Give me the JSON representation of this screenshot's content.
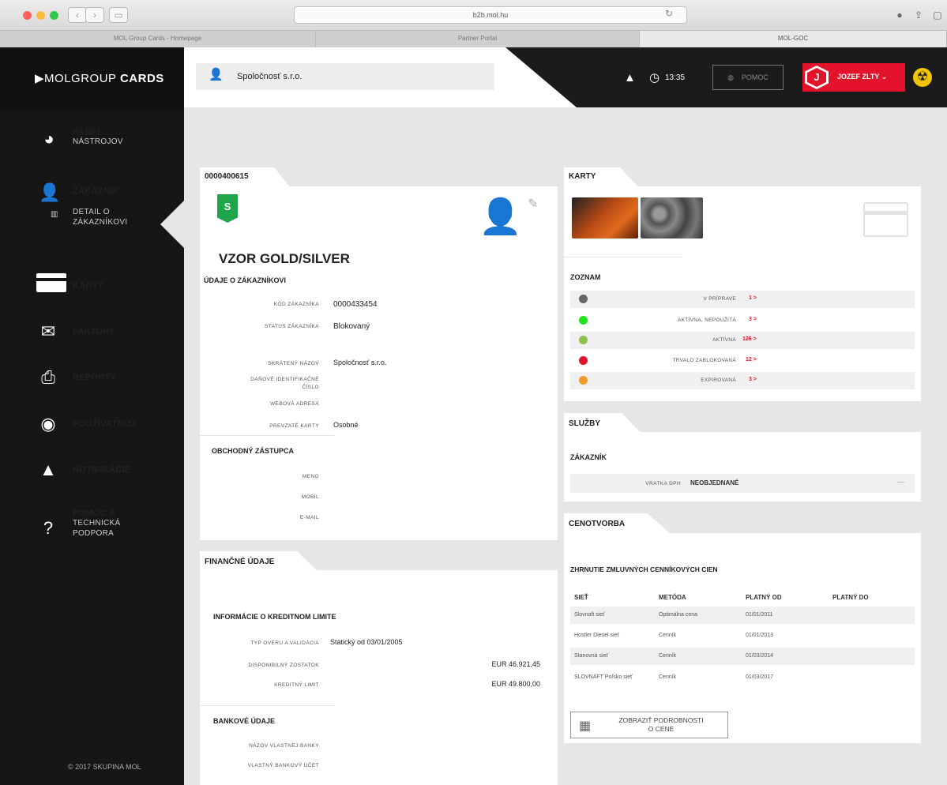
{
  "browser": {
    "url": "b2b.mol.hu",
    "tabs": [
      "MOL Group Cards - Homepage",
      "Partner Portal",
      "MOL-GOC"
    ]
  },
  "sidebar": {
    "logo_prefix": "MOLGROUP",
    "logo_bold": "CARDS",
    "items": [
      {
        "icon": "dashboard-icon",
        "label": "PANEL",
        "sub": "NÁSTROJOV"
      },
      {
        "icon": "user-icon",
        "label": "ZÁKAZNÍK",
        "sub": "DETAIL O ZÁKAZNÍKOVI"
      },
      {
        "icon": "card-icon",
        "label": "KARTY"
      },
      {
        "icon": "envelope-icon",
        "label": "FAKTÚRY"
      },
      {
        "icon": "inbox-icon",
        "label": "REPORTY"
      },
      {
        "icon": "user-circle-icon",
        "label": "POUŽÍVATELIA"
      },
      {
        "icon": "warning-icon",
        "label": "NOTIFIKÁCIE"
      },
      {
        "icon": "help-icon",
        "label": "POMOC A",
        "sub": "TECHNICKÁ PODPORA"
      }
    ],
    "copyright": "© 2017 SKUPINA MOL"
  },
  "header": {
    "company": "Spoločnosť s.r.o.",
    "time": "13:35",
    "help_label": "POMOC",
    "user_initial": "J",
    "user_name": "JOZEF ZLTY"
  },
  "customer": {
    "id": "0000400615",
    "badge": "S",
    "name": "VZOR GOLD/SILVER",
    "section_title": "ÚDAJE O ZÁKAZNÍKOVI",
    "fields": [
      {
        "label": "KÓD ZÁKAZNÍKA",
        "value": "0000433454"
      },
      {
        "label": "STATUS ZÁKAZNÍKA",
        "value": "Blokovaný"
      },
      {
        "label": "SKRÁTENÝ NÁZOV",
        "value": "Spoločnosť s.r.o."
      },
      {
        "label": "DAŇOVÉ IDENTIFIKAČNÉ ČÍSLO",
        "value": ""
      },
      {
        "label": "WEBOVÁ ADRESA",
        "value": ""
      },
      {
        "label": "PREVZATÉ KARTY",
        "value": "Osobné"
      }
    ],
    "rep_title": "OBCHODNÝ ZÁSTUPCA",
    "rep_fields": [
      "MENO",
      "MOBIL",
      "E-MAIL"
    ]
  },
  "financial": {
    "title": "FINANČNÉ ÚDAJE",
    "credit_title": "INFORMÁCIE O KREDITNOM LIMITE",
    "fields": [
      {
        "label": "TYP OVERU A VALIDÁCIA",
        "value": "Statický od 03/01/2005"
      },
      {
        "label": "DISPONIBILNÝ ZOSTATOK",
        "value": "EUR 46.921,45"
      },
      {
        "label": "KREDITNÝ LIMIT",
        "value": "EUR 49.800,00"
      }
    ],
    "bank_title": "BANKOVÉ ÚDAJE",
    "bank_fields": [
      "NÁZOV VLASTNEJ BANKY",
      "VLASTNÝ BANKOVÝ ÚČET"
    ]
  },
  "cards": {
    "title": "KARTY",
    "list_title": "ZOZNAM",
    "statuses": [
      {
        "label": "V PRÍPRAVE",
        "count": "1 >",
        "color": "#666666"
      },
      {
        "label": "AKTÍVNA, NEPOUŽITÁ",
        "count": "3 >",
        "color": "#1ee51e"
      },
      {
        "label": "AKTÍVNA",
        "count": "126 >",
        "color": "#8bc34a"
      },
      {
        "label": "TRVALO ZABLOKOVANÁ",
        "count": "12 >",
        "color": "#e3132b"
      },
      {
        "label": "EXPIROVANÁ",
        "count": "3 >",
        "color": "#f39a2c"
      }
    ]
  },
  "services": {
    "title": "SLUŽBY",
    "subtitle": "ZÁKAZNÍK",
    "row_label": "VRATKA DPH",
    "row_value": "NEOBJEDNANÉ",
    "row_dash": "—"
  },
  "pricing": {
    "title": "CENOTVORBA",
    "subtitle": "ZHRNUTIE ZMLUVNÝCH CENNÍKOVÝCH CIEN",
    "headers": [
      "SIEŤ",
      "METÓDA",
      "PLATNÝ OD",
      "PLATNÝ DO"
    ],
    "rows": [
      [
        "Slovnaft sieť",
        "Optimálna cena",
        "01/01/2011",
        ""
      ],
      [
        "Hostler Diesel sieť",
        "Cenník",
        "01/01/2013",
        ""
      ],
      [
        "Stanovná sieť",
        "Cenník",
        "01/03/2014",
        ""
      ],
      [
        "SLOVNAFT Poľsko sieť",
        "Cenník",
        "01/03/2017",
        ""
      ]
    ],
    "button_label_1": "ZOBRAZIŤ PODROBNOSTI",
    "button_label_2": "O CENE"
  },
  "colors": {
    "accent": "#e3132b",
    "badge": "#1fa64a",
    "sidebar": "#161616"
  }
}
